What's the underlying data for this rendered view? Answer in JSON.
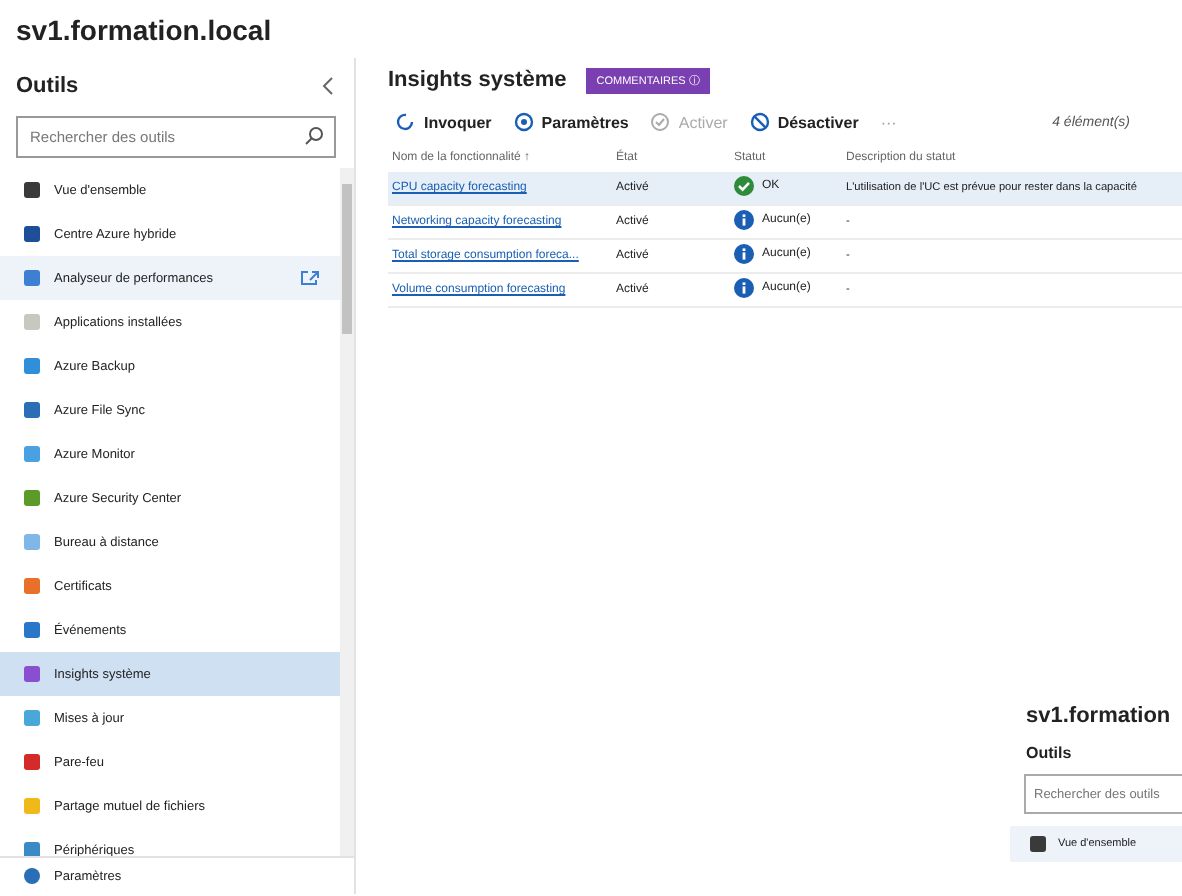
{
  "window": {
    "title": "sv1.formation.local"
  },
  "sidebar": {
    "title": "Outils",
    "search": {
      "placeholder": "Rechercher des outils"
    },
    "items": [
      {
        "label": "Vue d'ensemble",
        "color": "#3a3a3a",
        "selected": false,
        "highlighted": false
      },
      {
        "label": "Centre Azure hybride",
        "color": "#1f4e99",
        "selected": false,
        "highlighted": false
      },
      {
        "label": "Analyseur de performances",
        "color": "#3d7fd1",
        "selected": false,
        "highlighted": true,
        "external_link": true
      },
      {
        "label": "Applications installées",
        "color": "#c8c8c0",
        "selected": false,
        "highlighted": false
      },
      {
        "label": "Azure Backup",
        "color": "#2f8fd8",
        "selected": false,
        "highlighted": false
      },
      {
        "label": "Azure File Sync",
        "color": "#2a6fb5",
        "selected": false,
        "highlighted": false
      },
      {
        "label": "Azure Monitor",
        "color": "#4aa0e0",
        "selected": false,
        "highlighted": false
      },
      {
        "label": "Azure Security Center",
        "color": "#5a9b2a",
        "selected": false,
        "highlighted": false
      },
      {
        "label": "Bureau à distance",
        "color": "#7fb8e8",
        "selected": false,
        "highlighted": false
      },
      {
        "label": "Certificats",
        "color": "#e8702a",
        "selected": false,
        "highlighted": false
      },
      {
        "label": "Événements",
        "color": "#2a76c8",
        "selected": false,
        "highlighted": false
      },
      {
        "label": "Insights système",
        "color": "#8a4fd0",
        "selected": true,
        "highlighted": false
      },
      {
        "label": "Mises à jour",
        "color": "#4aa8d8",
        "selected": false,
        "highlighted": false
      },
      {
        "label": "Pare-feu",
        "color": "#d42a2a",
        "selected": false,
        "highlighted": false
      },
      {
        "label": "Partage mutuel de fichiers",
        "color": "#f0b818",
        "selected": false,
        "highlighted": false
      },
      {
        "label": "Périphériques",
        "color": "#3a8ac8",
        "selected": false,
        "highlighted": false
      }
    ],
    "footer_item": {
      "label": "Paramètres",
      "color": "#2a6fb5"
    }
  },
  "main": {
    "title": "Insights système",
    "badge": "COMMENTAIRES ⓘ",
    "toolbar": [
      {
        "label": "Invoquer",
        "kind": "invoke",
        "disabled": false
      },
      {
        "label": "Paramètres",
        "kind": "settings",
        "disabled": false
      },
      {
        "label": "Activer",
        "kind": "enable",
        "disabled": true
      },
      {
        "label": "Désactiver",
        "kind": "disable",
        "disabled": false
      }
    ],
    "more": "···",
    "count": "4 élément(s)",
    "table": {
      "columns": [
        "Nom de la fonctionnalité ↑",
        "État",
        "Statut",
        "Description du statut"
      ],
      "rows": [
        {
          "name": "CPU capacity forecasting",
          "state": "Activé",
          "status": "OK",
          "kind": "ok",
          "description": "L'utilisation de l'UC est prévue pour rester dans la capacité",
          "selected": true
        },
        {
          "name": "Networking capacity forecasting",
          "state": "Activé",
          "status": "Aucun(e)",
          "kind": "info",
          "description": "-",
          "selected": false
        },
        {
          "name": "Total storage consumption foreca...",
          "state": "Activé",
          "status": "Aucun(e)",
          "kind": "info",
          "description": "-",
          "selected": false
        },
        {
          "name": "Volume consumption forecasting",
          "state": "Activé",
          "status": "Aucun(e)",
          "kind": "info",
          "description": "-",
          "selected": false
        }
      ]
    }
  },
  "inset": {
    "title": "sv1.formation",
    "sidebar_title": "Outils",
    "search": {
      "placeholder": "Rechercher des outils"
    },
    "item": {
      "label": "Vue d'ensemble",
      "color": "#3a3a3a"
    }
  }
}
